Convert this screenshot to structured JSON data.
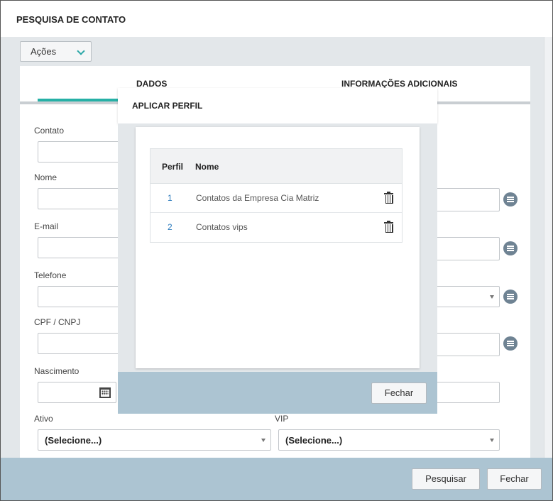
{
  "window": {
    "title": "PESQUISA DE CONTATO"
  },
  "toolbar": {
    "actions_label": "Ações"
  },
  "tabs": [
    {
      "label": "DADOS",
      "active": true
    },
    {
      "label": "INFORMAÇÕES ADICIONAIS",
      "active": false
    }
  ],
  "form": {
    "contato_label": "Contato",
    "nome_label": "Nome",
    "email_label": "E-mail",
    "telefone_label": "Telefone",
    "cpf_label": "CPF / CNPJ",
    "nascimento_label": "Nascimento",
    "ativo_label": "Ativo",
    "ativo_value": "(Selecione...)",
    "vip_label": "VIP",
    "vip_value": "(Selecione...)"
  },
  "footer": {
    "search_label": "Pesquisar",
    "close_label": "Fechar"
  },
  "modal": {
    "title": "APLICAR PERFIL",
    "columns": [
      "Perfil",
      "Nome"
    ],
    "rows": [
      {
        "perfil": "1",
        "nome": "Contatos da Empresa Cia Matriz"
      },
      {
        "perfil": "2",
        "nome": "Contatos vips"
      }
    ],
    "close_label": "Fechar"
  },
  "colors": {
    "accent": "#26b0a6",
    "footer": "#acc4d2",
    "link": "#2b7bbd"
  }
}
